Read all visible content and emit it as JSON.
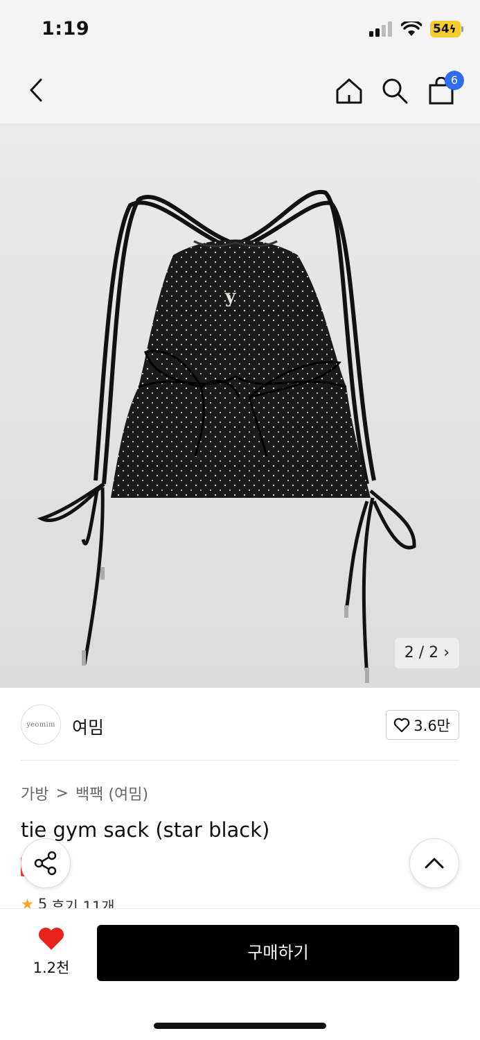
{
  "status": {
    "time": "1:19",
    "battery": "54"
  },
  "nav": {
    "cart_count": "6"
  },
  "gallery": {
    "counter": "2 / 2"
  },
  "brand": {
    "logo_text": "yeomim",
    "name": "여밈",
    "favorite_count": "3.6만"
  },
  "breadcrumb": {
    "category": "가방",
    "separator": ">",
    "subcategory": "백팩 (여밈)"
  },
  "product": {
    "title": "tie gym sack (star black)",
    "rating": "5",
    "review_text": "후기 11개"
  },
  "footer": {
    "like_count": "1.2천",
    "buy_label": "구매하기"
  },
  "colors": {
    "accent_blue": "#2f6cf0",
    "battery_yellow": "#f7cd2e",
    "heart_red": "#e8231b",
    "star_orange": "#f5a623"
  }
}
